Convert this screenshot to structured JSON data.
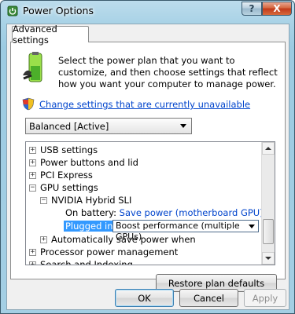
{
  "window": {
    "title": "Power Options",
    "help_glyph": "?",
    "close_glyph": "X",
    "icon": "power-options-icon"
  },
  "tab": {
    "label": "Advanced settings"
  },
  "intro": {
    "text": "Select the power plan that you want to customize, and then choose settings that reflect how you want your computer to manage power.",
    "icon": "battery-power-icon"
  },
  "change_link": {
    "text": "Change settings that are currently unavailable",
    "icon": "uac-shield-icon"
  },
  "plan_select": {
    "value": "Balanced [Active]"
  },
  "tree": {
    "items": [
      {
        "label": "USB settings",
        "expander": "+"
      },
      {
        "label": "Power buttons and lid",
        "expander": "+"
      },
      {
        "label": "PCI Express",
        "expander": "+"
      },
      {
        "label": "GPU settings",
        "expander": "−"
      },
      {
        "label": "NVIDIA Hybrid SLI",
        "expander": "−"
      },
      {
        "label": "Automatically save power when",
        "expander": "+"
      },
      {
        "label": "Processor power management",
        "expander": "+"
      },
      {
        "label": "Search and Indexing",
        "expander": "+"
      }
    ],
    "on_battery": {
      "label": "On battery:",
      "value": "Save power (motherboard GPU)"
    },
    "plugged_in": {
      "label": "Plugged in:",
      "value": "Boost performance (multiple GPUs)"
    }
  },
  "buttons": {
    "restore": "Restore plan defaults",
    "ok": "OK",
    "cancel": "Cancel",
    "apply": "Apply"
  },
  "colors": {
    "link": "#0044cc",
    "selection": "#3399ff",
    "close_button": "#c1391a"
  }
}
